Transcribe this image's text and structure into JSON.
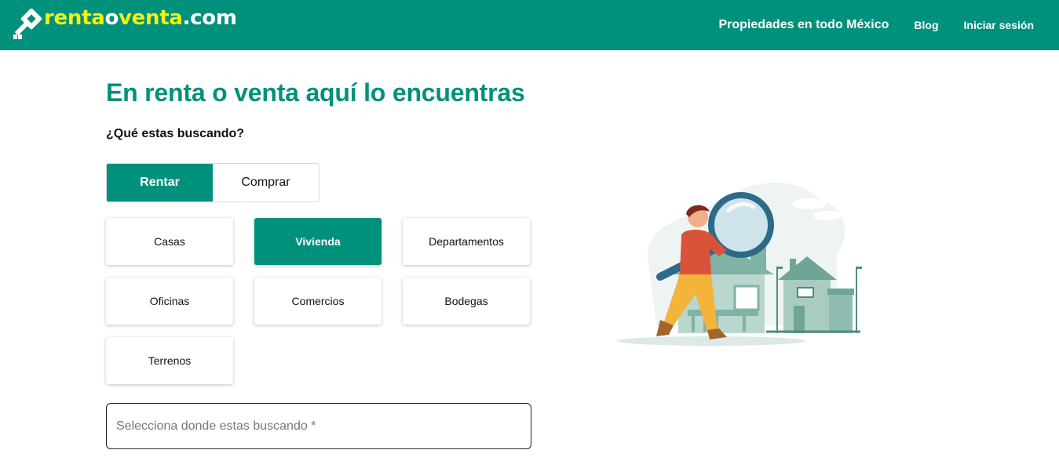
{
  "header": {
    "logo_part1": "renta",
    "logo_part2": "o",
    "logo_part3": "venta",
    "logo_part4": ".com",
    "nav": [
      "Propiedades en todo México",
      "Blog",
      "Iniciar sesión"
    ]
  },
  "main": {
    "title": "En renta o venta aquí lo encuentras",
    "subtitle": "¿Qué estas buscando?",
    "toggle": {
      "selected": "Rentar",
      "options": [
        "Rentar",
        "Comprar"
      ]
    },
    "categories": [
      "Casas",
      "Vivienda",
      "Departamentos",
      "Oficinas",
      "Comercios",
      "Bodegas",
      "Terrenos"
    ],
    "selected_category": "Vivienda",
    "search_placeholder": "Selecciona donde estas buscando *"
  },
  "colors": {
    "brand": "#00917c",
    "logo_yellow": "#f2f20a"
  }
}
